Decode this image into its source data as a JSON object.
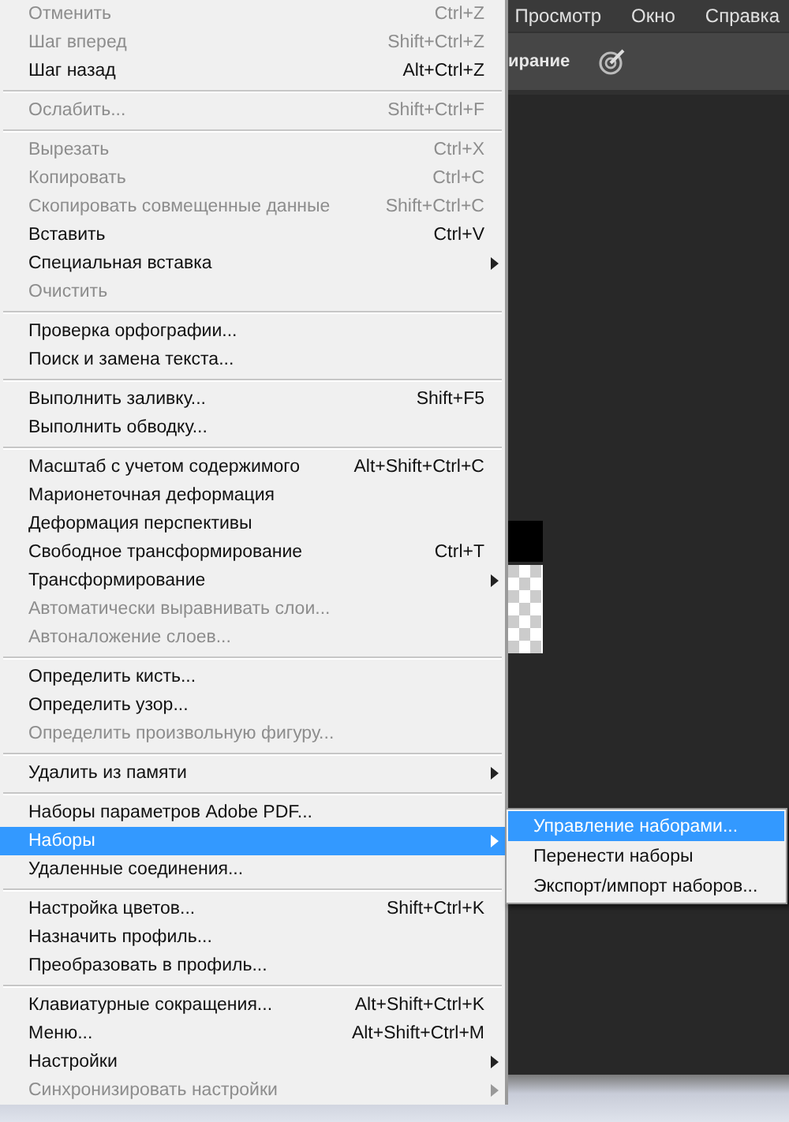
{
  "menubar": {
    "items": [
      "Просмотр",
      "Окно",
      "Справка"
    ]
  },
  "toolbar": {
    "text": "ирание"
  },
  "menu": {
    "sections": [
      [
        {
          "label": "Отменить",
          "shortcut": "Ctrl+Z",
          "disabled": true,
          "submenu": false,
          "selected": false
        },
        {
          "label": "Шаг вперед",
          "shortcut": "Shift+Ctrl+Z",
          "disabled": true,
          "submenu": false,
          "selected": false
        },
        {
          "label": "Шаг назад",
          "shortcut": "Alt+Ctrl+Z",
          "disabled": false,
          "submenu": false,
          "selected": false
        }
      ],
      [
        {
          "label": "Ослабить...",
          "shortcut": "Shift+Ctrl+F",
          "disabled": true,
          "submenu": false,
          "selected": false
        }
      ],
      [
        {
          "label": "Вырезать",
          "shortcut": "Ctrl+X",
          "disabled": true,
          "submenu": false,
          "selected": false
        },
        {
          "label": "Копировать",
          "shortcut": "Ctrl+C",
          "disabled": true,
          "submenu": false,
          "selected": false
        },
        {
          "label": "Скопировать совмещенные данные",
          "shortcut": "Shift+Ctrl+C",
          "disabled": true,
          "submenu": false,
          "selected": false
        },
        {
          "label": "Вставить",
          "shortcut": "Ctrl+V",
          "disabled": false,
          "submenu": false,
          "selected": false
        },
        {
          "label": "Специальная вставка",
          "disabled": false,
          "submenu": true,
          "selected": false
        },
        {
          "label": "Очистить",
          "disabled": true,
          "submenu": false,
          "selected": false
        }
      ],
      [
        {
          "label": "Проверка орфографии...",
          "disabled": false,
          "submenu": false,
          "selected": false
        },
        {
          "label": "Поиск и замена текста...",
          "disabled": false,
          "submenu": false,
          "selected": false
        }
      ],
      [
        {
          "label": "Выполнить заливку...",
          "shortcut": "Shift+F5",
          "disabled": false,
          "submenu": false,
          "selected": false
        },
        {
          "label": "Выполнить обводку...",
          "disabled": false,
          "submenu": false,
          "selected": false
        }
      ],
      [
        {
          "label": "Масштаб с учетом содержимого",
          "shortcut": "Alt+Shift+Ctrl+C",
          "disabled": false,
          "submenu": false,
          "selected": false
        },
        {
          "label": "Марионеточная деформация",
          "disabled": false,
          "submenu": false,
          "selected": false
        },
        {
          "label": "Деформация перспективы",
          "disabled": false,
          "submenu": false,
          "selected": false
        },
        {
          "label": "Свободное трансформирование",
          "shortcut": "Ctrl+T",
          "disabled": false,
          "submenu": false,
          "selected": false
        },
        {
          "label": "Трансформирование",
          "disabled": false,
          "submenu": true,
          "selected": false
        },
        {
          "label": "Автоматически выравнивать слои...",
          "disabled": true,
          "submenu": false,
          "selected": false
        },
        {
          "label": "Автоналожение слоев...",
          "disabled": true,
          "submenu": false,
          "selected": false
        }
      ],
      [
        {
          "label": "Определить кисть...",
          "disabled": false,
          "submenu": false,
          "selected": false
        },
        {
          "label": "Определить узор...",
          "disabled": false,
          "submenu": false,
          "selected": false
        },
        {
          "label": "Определить произвольную фигуру...",
          "disabled": true,
          "submenu": false,
          "selected": false
        }
      ],
      [
        {
          "label": "Удалить из памяти",
          "disabled": false,
          "submenu": true,
          "selected": false
        }
      ],
      [
        {
          "label": "Наборы параметров Adobe PDF...",
          "disabled": false,
          "submenu": false,
          "selected": false
        },
        {
          "label": "Наборы",
          "disabled": false,
          "submenu": true,
          "selected": true
        },
        {
          "label": "Удаленные соединения...",
          "disabled": false,
          "submenu": false,
          "selected": false
        }
      ],
      [
        {
          "label": "Настройка цветов...",
          "shortcut": "Shift+Ctrl+K",
          "disabled": false,
          "submenu": false,
          "selected": false
        },
        {
          "label": "Назначить профиль...",
          "disabled": false,
          "submenu": false,
          "selected": false
        },
        {
          "label": "Преобразовать в профиль...",
          "disabled": false,
          "submenu": false,
          "selected": false
        }
      ],
      [
        {
          "label": "Клавиатурные сокращения...",
          "shortcut": "Alt+Shift+Ctrl+K",
          "disabled": false,
          "submenu": false,
          "selected": false
        },
        {
          "label": "Меню...",
          "shortcut": "Alt+Shift+Ctrl+M",
          "disabled": false,
          "submenu": false,
          "selected": false
        },
        {
          "label": "Настройки",
          "disabled": false,
          "submenu": true,
          "selected": false
        },
        {
          "label": "Синхронизировать настройки",
          "disabled": true,
          "submenu": true,
          "selected": false
        }
      ]
    ]
  },
  "submenu": {
    "items": [
      {
        "label": "Управление наборами...",
        "selected": true
      },
      {
        "label": "Перенести наборы",
        "selected": false
      },
      {
        "label": "Экспорт/импорт наборов...",
        "selected": false
      }
    ]
  }
}
